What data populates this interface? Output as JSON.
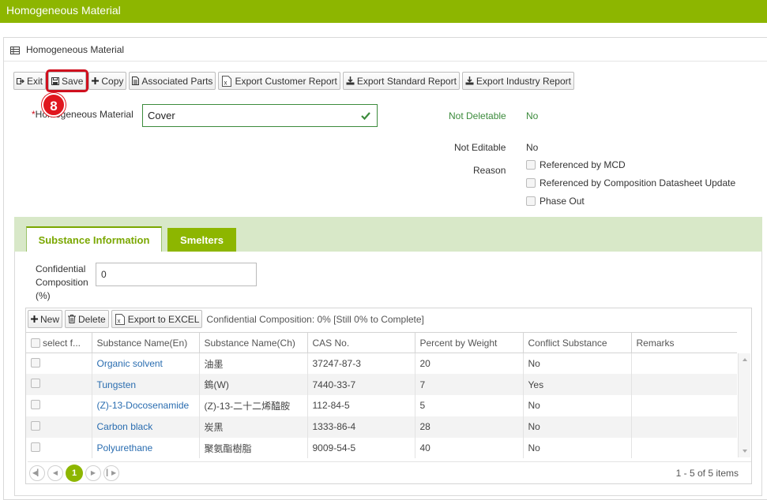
{
  "header": {
    "title": "Homogeneous Material"
  },
  "panel": {
    "title": "Homogeneous Material"
  },
  "toolbar": {
    "exit": "Exit",
    "save": "Save",
    "copy": "Copy",
    "associated_parts": "Associated Parts",
    "export_customer": "Export Customer Report",
    "export_standard": "Export Standard Report",
    "export_industry": "Export Industry Report"
  },
  "step_badge": "8",
  "form": {
    "required_mark": "*",
    "hm_label": "Homogeneous Material",
    "hm_value": "Cover",
    "not_deletable_label": "Not Deletable",
    "not_deletable_value": "No",
    "not_editable_label": "Not Editable",
    "not_editable_value": "No",
    "reason_label": "Reason",
    "reasons": [
      "Referenced by MCD",
      "Referenced by Composition Datasheet Update",
      "Phase Out"
    ]
  },
  "tabs": {
    "substance": "Substance Information",
    "smelters": "Smelters"
  },
  "confidential": {
    "label": "Confidential Composition (%)",
    "value": "0"
  },
  "grid": {
    "new": "New",
    "delete": "Delete",
    "export_excel": "Export to EXCEL",
    "info": "Confidential Composition: 0% [Still 0% to Complete]",
    "columns": [
      "select f...",
      "Substance Name(En)",
      "Substance Name(Ch)",
      "CAS No.",
      "Percent by Weight",
      "Conflict Substance",
      "Remarks"
    ],
    "rows": [
      {
        "en": "Organic solvent",
        "ch": "油墨",
        "cas": "37247-87-3",
        "pct": "20",
        "conflict": "No",
        "remarks": ""
      },
      {
        "en": "Tungsten",
        "ch": "鎢(W)",
        "cas": "7440-33-7",
        "pct": "7",
        "conflict": "Yes",
        "remarks": ""
      },
      {
        "en": "(Z)-13-Docosenamide",
        "ch": "(Z)-13-二十二烯醯胺",
        "cas": "112-84-5",
        "pct": "5",
        "conflict": "No",
        "remarks": ""
      },
      {
        "en": "Carbon black",
        "ch": "炭黑",
        "cas": "1333-86-4",
        "pct": "28",
        "conflict": "No",
        "remarks": ""
      },
      {
        "en": "Polyurethane",
        "ch": "聚氨酯樹脂",
        "cas": "9009-54-5",
        "pct": "40",
        "conflict": "No",
        "remarks": ""
      }
    ],
    "current_page": "1",
    "page_info": "1 - 5 of 5 items"
  },
  "colors": {
    "brand_green": "#8db600",
    "highlight_red": "#d0101e",
    "link_blue": "#2a6db0"
  }
}
